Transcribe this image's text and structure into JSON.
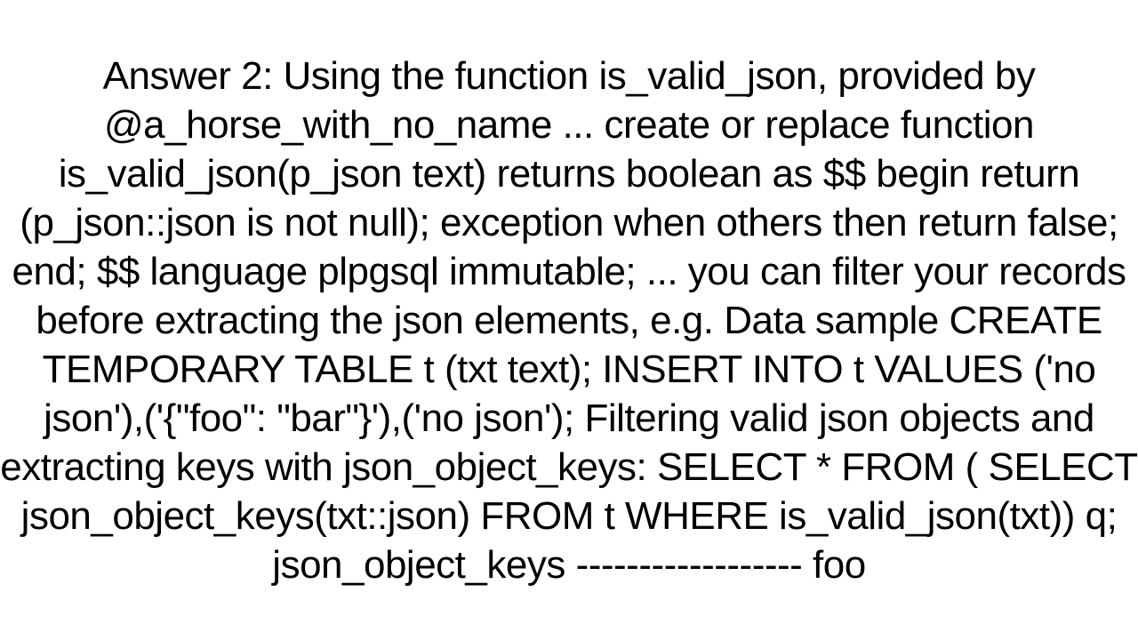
{
  "content": {
    "body": "Answer 2: Using the function is_valid_json, provided by @a_horse_with_no_name ... create or replace function is_valid_json(p_json text) returns boolean as $$ begin   return (p_json::json is not null); exception    when others then      return false;   end; $$ language plpgsql immutable;  ... you can filter your records before extracting the json elements, e.g. Data sample CREATE TEMPORARY TABLE t (txt text); INSERT INTO t VALUES ('no json'),('{\"foo\": \"bar\"}'),('no json');  Filtering valid json objects and extracting keys with json_object_keys: SELECT * FROM (   SELECT json_object_keys(txt::json) FROM t   WHERE is_valid_json(txt)) q;   json_object_keys  ------------------  foo"
  }
}
